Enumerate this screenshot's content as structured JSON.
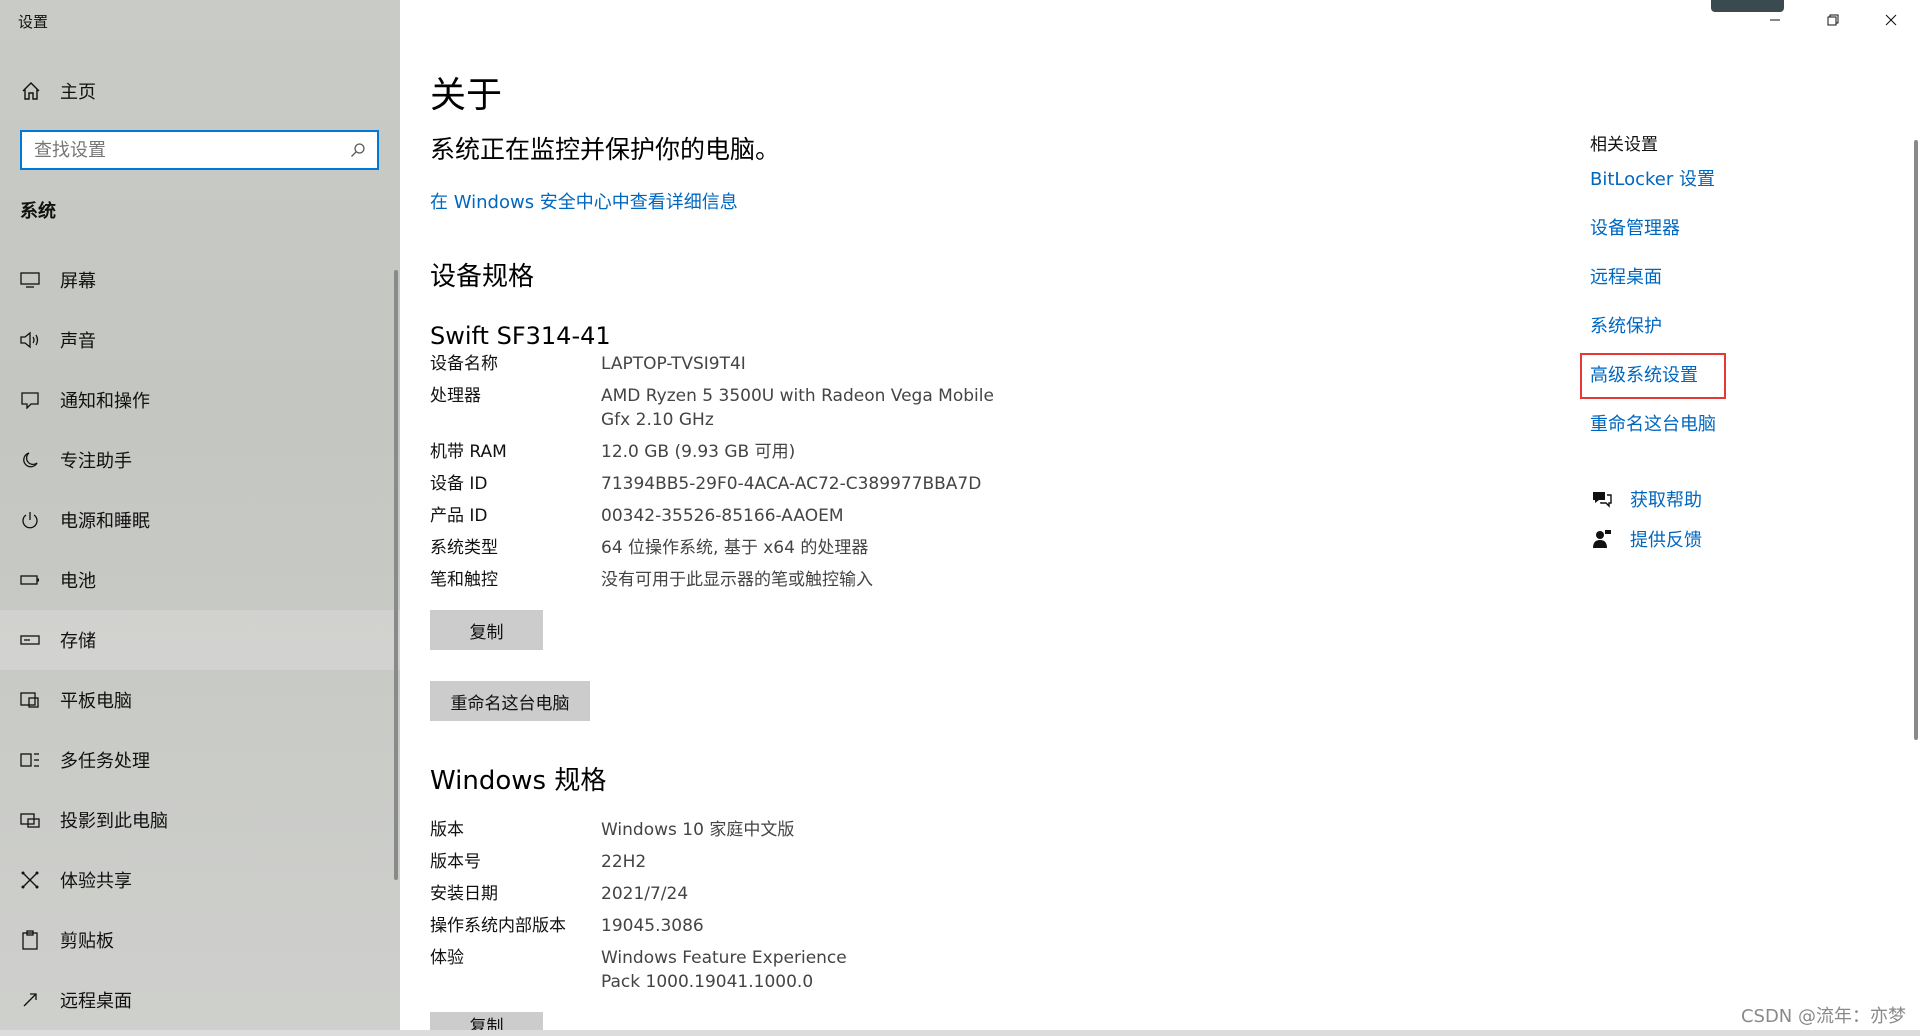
{
  "window": {
    "title": "设置"
  },
  "sidebar": {
    "home_label": "主页",
    "search_placeholder": "查找设置",
    "section_title": "系统",
    "items": [
      {
        "label": "屏幕",
        "icon": "monitor-icon"
      },
      {
        "label": "声音",
        "icon": "speaker-icon"
      },
      {
        "label": "通知和操作",
        "icon": "notification-icon"
      },
      {
        "label": "专注助手",
        "icon": "moon-icon"
      },
      {
        "label": "电源和睡眠",
        "icon": "power-icon"
      },
      {
        "label": "电池",
        "icon": "battery-icon"
      },
      {
        "label": "存储",
        "icon": "storage-icon",
        "active": true
      },
      {
        "label": "平板电脑",
        "icon": "tablet-icon"
      },
      {
        "label": "多任务处理",
        "icon": "multitask-icon"
      },
      {
        "label": "投影到此电脑",
        "icon": "project-icon"
      },
      {
        "label": "体验共享",
        "icon": "share-icon"
      },
      {
        "label": "剪贴板",
        "icon": "clipboard-icon"
      },
      {
        "label": "远程桌面",
        "icon": "remote-desktop-icon"
      }
    ]
  },
  "main": {
    "title": "关于",
    "protect_text": "系统正在监控并保护你的电脑。",
    "security_link": "在 Windows 安全中心中查看详细信息",
    "device_spec_title": "设备规格",
    "device_model": "Swift SF314-41",
    "device_specs": [
      {
        "key": "设备名称",
        "value": "LAPTOP-TVSI9T4I"
      },
      {
        "key": "处理器",
        "value": "AMD Ryzen 5 3500U with Radeon Vega Mobile Gfx     2.10 GHz"
      },
      {
        "key": "机带 RAM",
        "value": "12.0 GB (9.93 GB 可用)"
      },
      {
        "key": "设备 ID",
        "value": "71394BB5-29F0-4ACA-AC72-C389977BBA7D"
      },
      {
        "key": "产品 ID",
        "value": "00342-35526-85166-AAOEM"
      },
      {
        "key": "系统类型",
        "value": "64 位操作系统, 基于 x64 的处理器"
      },
      {
        "key": "笔和触控",
        "value": "没有可用于此显示器的笔或触控输入"
      }
    ],
    "copy_button": "复制",
    "rename_button": "重命名这台电脑",
    "windows_spec_title": "Windows 规格",
    "windows_specs": [
      {
        "key": "版本",
        "value": "Windows 10 家庭中文版"
      },
      {
        "key": "版本号",
        "value": "22H2"
      },
      {
        "key": "安装日期",
        "value": "2021/7/24"
      },
      {
        "key": "操作系统内部版本",
        "value": "19045.3086"
      },
      {
        "key": "体验",
        "value": "Windows Feature Experience Pack 1000.19041.1000.0"
      }
    ],
    "copy_button_2": "复制"
  },
  "related": {
    "title": "相关设置",
    "links": [
      "BitLocker 设置",
      "设备管理器",
      "远程桌面",
      "系统保护",
      "高级系统设置",
      "重命名这台电脑"
    ],
    "highlighted_index": 4,
    "help_label": "获取帮助",
    "feedback_label": "提供反馈"
  },
  "watermark": "CSDN @流年：亦梦",
  "colors": {
    "accent": "#0078d7",
    "link": "#0067c0",
    "highlight": "#e53935"
  }
}
